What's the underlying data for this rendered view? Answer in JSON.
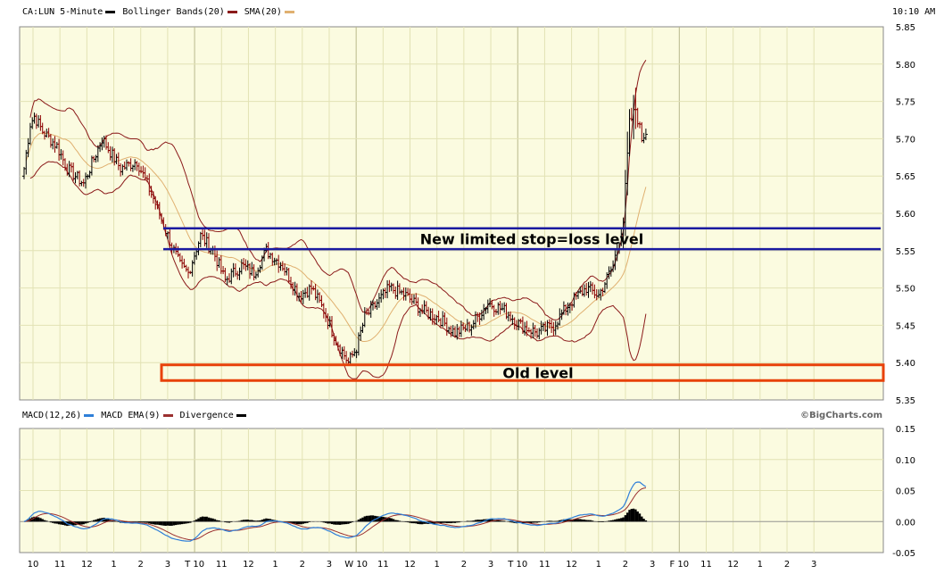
{
  "header": {
    "symbol_label": "CA:LUN 5-Minute",
    "bollinger_label": "Bollinger Bands(20)",
    "sma_label": "SMA(20)",
    "time": "10:10 AM",
    "macd_label": "MACD(12,26)",
    "macd_ema_label": "MACD EMA(9)",
    "divergence_label": "Divergence",
    "watermark": "©BigCharts.com"
  },
  "colors": {
    "price_up": "#000000",
    "price_down": "#8b0000",
    "bollinger": "#8b1a1a",
    "sma": "#e0b070",
    "macd": "#2f7fd8",
    "macd_ema": "#9b3030",
    "divergence": "#000000",
    "annotation_blue": "#1a1aa0",
    "annotation_orange": "#e8420a",
    "plot_bg": "#fbfbe0",
    "grid": "#e2e2b4"
  },
  "chart_data": [
    {
      "type": "ohlc",
      "ylim": [
        5.35,
        5.85
      ],
      "yticks": [
        "5.85",
        "5.80",
        "5.75",
        "5.70",
        "5.65",
        "5.60",
        "5.55",
        "5.50",
        "5.45",
        "5.40",
        "5.35"
      ],
      "x_labels": [
        "10",
        "11",
        "12",
        "1",
        "2",
        "3",
        "T 10",
        "11",
        "12",
        "1",
        "2",
        "3",
        "W 10",
        "11",
        "12",
        "1",
        "2",
        "3",
        "T 10",
        "11",
        "12",
        "1",
        "2",
        "3",
        "F 10",
        "11",
        "12",
        "1",
        "2",
        "3"
      ],
      "close_anchors": [
        [
          0,
          5.66
        ],
        [
          3,
          5.72
        ],
        [
          5,
          5.73
        ],
        [
          9,
          5.71
        ],
        [
          16,
          5.69
        ],
        [
          21,
          5.66
        ],
        [
          29,
          5.64
        ],
        [
          38,
          5.7
        ],
        [
          47,
          5.66
        ],
        [
          55,
          5.67
        ],
        [
          63,
          5.62
        ],
        [
          70,
          5.57
        ],
        [
          76,
          5.53
        ],
        [
          80,
          5.52
        ],
        [
          86,
          5.57
        ],
        [
          92,
          5.55
        ],
        [
          98,
          5.51
        ],
        [
          106,
          5.53
        ],
        [
          112,
          5.52
        ],
        [
          118,
          5.55
        ],
        [
          126,
          5.53
        ],
        [
          134,
          5.49
        ],
        [
          140,
          5.5
        ],
        [
          146,
          5.47
        ],
        [
          152,
          5.43
        ],
        [
          158,
          5.4
        ],
        [
          162,
          5.42
        ],
        [
          166,
          5.46
        ],
        [
          172,
          5.48
        ],
        [
          178,
          5.5
        ],
        [
          186,
          5.49
        ],
        [
          194,
          5.47
        ],
        [
          202,
          5.46
        ],
        [
          210,
          5.44
        ],
        [
          218,
          5.45
        ],
        [
          226,
          5.48
        ],
        [
          234,
          5.47
        ],
        [
          242,
          5.45
        ],
        [
          250,
          5.44
        ],
        [
          258,
          5.45
        ],
        [
          266,
          5.48
        ],
        [
          274,
          5.5
        ],
        [
          280,
          5.49
        ],
        [
          287,
          5.53
        ],
        [
          292,
          5.59
        ],
        [
          295,
          5.72
        ],
        [
          298,
          5.74
        ],
        [
          301,
          5.7
        ],
        [
          303,
          5.71
        ]
      ],
      "price_annotations": [
        {
          "label": "New limited stop=loss level",
          "upper": 5.58,
          "lower": 5.552
        },
        {
          "label": "Old level",
          "upper": 5.397,
          "lower": 5.376
        }
      ]
    },
    {
      "type": "macd",
      "ylim": [
        -0.05,
        0.15
      ],
      "yticks": [
        "0.15",
        "0.10",
        "0.05",
        "0.00",
        "-0.05"
      ]
    }
  ]
}
